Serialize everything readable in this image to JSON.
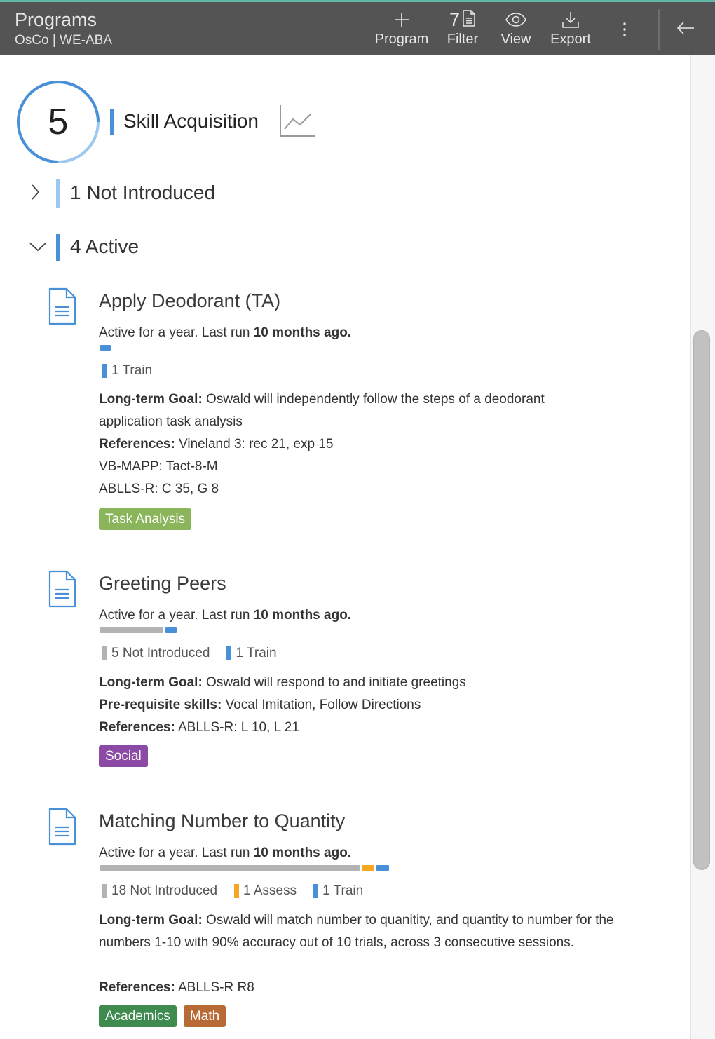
{
  "header": {
    "title": "Programs",
    "subtitle": "OsCo | WE-ABA",
    "program_label": "Program",
    "filter_count": "7",
    "filter_label": "Filter",
    "view_label": "View",
    "export_label": "Export"
  },
  "summary": {
    "count": "5",
    "title": "Skill Acquisition"
  },
  "groups": {
    "not_introduced": "1 Not Introduced",
    "active": "4 Active"
  },
  "colors": {
    "accent_blue": "#4a90d9",
    "light_blue": "#9cc8ef",
    "not_introduced_gray": "#b3b3b3",
    "assess_orange": "#f5a623",
    "tag_task_analysis": "#8ab55a",
    "tag_social": "#8a4aa6",
    "tag_academics": "#3f8a4e",
    "tag_math": "#b86a36"
  },
  "programs": [
    {
      "title": "Apply Deodorant (TA)",
      "active_prefix": "Active for a year. Last run ",
      "active_bold": "10 months ago.",
      "progress": [
        {
          "status": "Train",
          "count": 1
        }
      ],
      "legend": [
        "1 Train"
      ],
      "long_term_goal_label": "Long-term Goal:",
      "long_term_goal": " Oswald will independently follow the steps of a deodorant",
      "long_term_goal_2": "application task analysis",
      "references_label": "References:",
      "references": " Vineland 3: rec 21, exp 15",
      "references_2": "VB-MAPP: Tact-8-M",
      "references_3": "ABLLS-R: C 35, G 8",
      "tags": [
        "Task Analysis"
      ]
    },
    {
      "title": "Greeting Peers",
      "active_prefix": "Active for a year. Last run ",
      "active_bold": "10 months ago.",
      "progress": [
        {
          "status": "Not Introduced",
          "count": 5
        },
        {
          "status": "Train",
          "count": 1
        }
      ],
      "legend": [
        "5 Not Introduced",
        "1 Train"
      ],
      "long_term_goal_label": "Long-term Goal:",
      "long_term_goal": " Oswald will respond to and initiate greetings",
      "prereq_label": "Pre-requisite skills:",
      "prereq": " Vocal Imitation, Follow Directions",
      "references_label": "References:",
      "references": " ABLLS-R: L 10, L 21",
      "tags": [
        "Social"
      ]
    },
    {
      "title": "Matching Number to Quantity",
      "active_prefix": "Active for a year. Last run ",
      "active_bold": "10 months ago.",
      "progress": [
        {
          "status": "Not Introduced",
          "count": 18
        },
        {
          "status": "Assess",
          "count": 1
        },
        {
          "status": "Train",
          "count": 1
        }
      ],
      "legend": [
        "18 Not Introduced",
        "1 Assess",
        "1 Train"
      ],
      "long_term_goal_label": "Long-term Goal:",
      "long_term_goal": " Oswald will match number to quanitity, and quantity to number for the",
      "long_term_goal_2": "numbers 1-10 with 90% accuracy out of 10 trials, across 3 consecutive sessions.",
      "references_label": "References:",
      "references": " ABLLS-R R8",
      "tags": [
        "Academics",
        "Math"
      ]
    }
  ]
}
